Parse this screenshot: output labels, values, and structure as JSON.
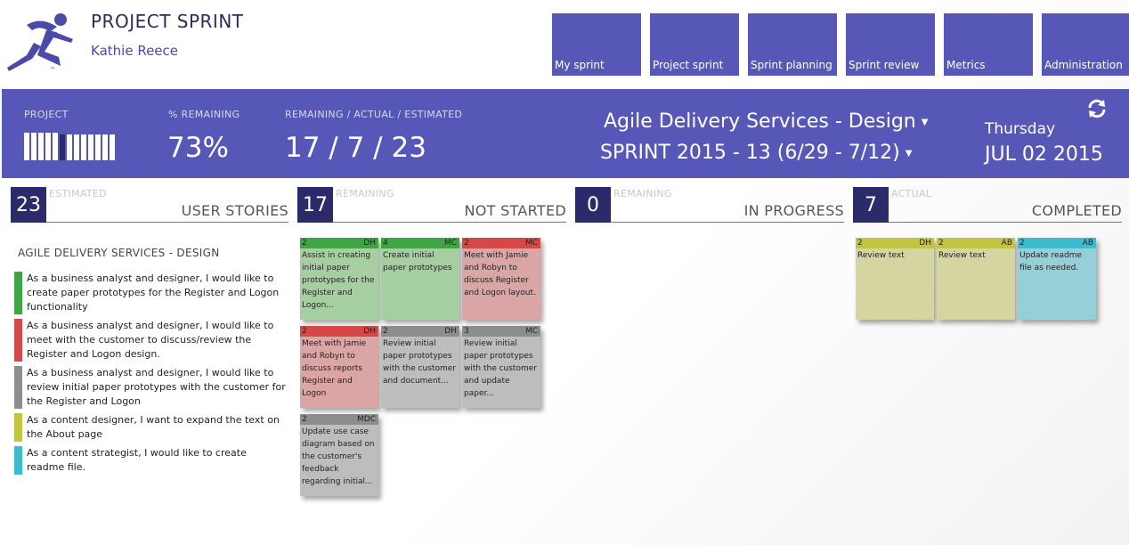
{
  "app": {
    "title": "PROJECT SPRINT",
    "user": "Kathie Reece"
  },
  "nav": [
    "My sprint",
    "Project sprint",
    "Sprint planning",
    "Sprint review",
    "Metrics",
    "Administration"
  ],
  "banner": {
    "project_label": "PROJECT",
    "remaining_pct_label": "% REMAINING",
    "remaining_pct_value": "73%",
    "rae_label": "REMAINING / ACTUAL / ESTIMATED",
    "rae_value": "17 / 7 / 23",
    "project_progress_fraction": 0.27,
    "project_name": "Agile Delivery Services - Design",
    "sprint_name": "SPRINT 2015 - 13 (6/29 - 7/12)",
    "day": "Thursday",
    "date": "JUL 02 2015"
  },
  "columns": [
    {
      "count": "23",
      "sub": "ESTIMATED",
      "title": "USER STORIES"
    },
    {
      "count": "17",
      "sub": "REMAINING",
      "title": "NOT STARTED"
    },
    {
      "count": "0",
      "sub": "REMAINING",
      "title": "IN PROGRESS"
    },
    {
      "count": "7",
      "sub": "ACTUAL",
      "title": "COMPLETED"
    }
  ],
  "stories": {
    "heading": "AGILE DELIVERY SERVICES - DESIGN",
    "items": [
      {
        "color": "#3fa444",
        "text": "As a business analyst and designer, I would like to create paper prototypes for the Register and Logon functionality"
      },
      {
        "color": "#d64848",
        "text": "As a business analyst and designer, I would like to meet with the customer to discuss/review the Register and Logon design."
      },
      {
        "color": "#8d8d8d",
        "text": "As a business analyst and designer, I would like to review initial paper prototypes with the customer for the Register and Logon"
      },
      {
        "color": "#c3c344",
        "text": "As a content designer, I want to expand the text on the About page"
      },
      {
        "color": "#3cbccc",
        "text": "As a content strategist, I would like to create readme file."
      }
    ]
  },
  "not_started": [
    {
      "points": "2",
      "owner": "DH",
      "color": "green",
      "text": "Assist in creating initial paper prototypes for the Register and Logon..."
    },
    {
      "points": "4",
      "owner": "MC",
      "color": "green",
      "text": "Create initial paper prototypes"
    },
    {
      "points": "2",
      "owner": "MC",
      "color": "red",
      "text": "Meet with Jamie and Robyn to discuss Register and Logon layout."
    },
    {
      "points": "2",
      "owner": "DH",
      "color": "red",
      "text": "Meet with Jamie and Robyn to discuss reports Register and Logon"
    },
    {
      "points": "2",
      "owner": "DH",
      "color": "gray",
      "text": "Review initial paper prototypes with the customer and document..."
    },
    {
      "points": "3",
      "owner": "MC",
      "color": "gray",
      "text": "Review initial paper prototypes with the customer and update paper..."
    },
    {
      "points": "2",
      "owner": "MDC",
      "color": "gray",
      "text": "Update use case diagram based on the customer's feedback regarding initial..."
    }
  ],
  "completed": [
    {
      "points": "2",
      "owner": "DH",
      "color": "olive",
      "text": "Review text"
    },
    {
      "points": "2",
      "owner": "AB",
      "color": "olive",
      "text": "Review text"
    },
    {
      "points": "2",
      "owner": "AB",
      "color": "cyan",
      "text": "Update readme file as needed."
    }
  ]
}
